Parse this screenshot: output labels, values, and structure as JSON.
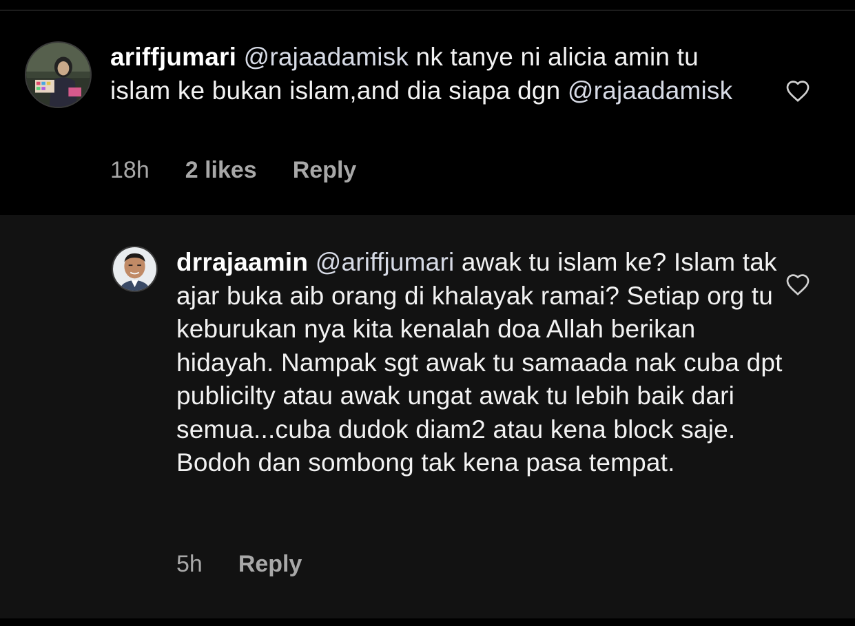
{
  "comments": [
    {
      "username": "ariffjumari",
      "mention": "@rajaadamisk",
      "text_a": " nk tanye ni alicia amin tu islam ke bukan islam,and dia siapa dgn ",
      "mention_2": "@rajaadamisk",
      "time": "18h",
      "likes": "2 likes",
      "reply_label": "Reply",
      "like_icon": "heart-outline-icon"
    },
    {
      "username": "drrajaamin",
      "mention": "@ariffjumari",
      "text_a": " awak tu islam ke? Islam tak ajar buka aib orang di khalayak ramai? Setiap org tu keburukan nya kita kenalah doa Allah berikan hidayah. Nampak sgt awak tu samaada nak cuba dpt publicilty atau awak ungat awak tu lebih baik dari semua...cuba dudok diam2 atau kena block saje. Bodoh dan sombong tak kena pasa tempat.",
      "time": "5h",
      "reply_label": "Reply",
      "like_icon": "heart-outline-icon"
    }
  ],
  "colors": {
    "background": "#000000",
    "reply_background": "#121212",
    "text": "#f2f2f2",
    "meta": "#a8a8a8"
  }
}
